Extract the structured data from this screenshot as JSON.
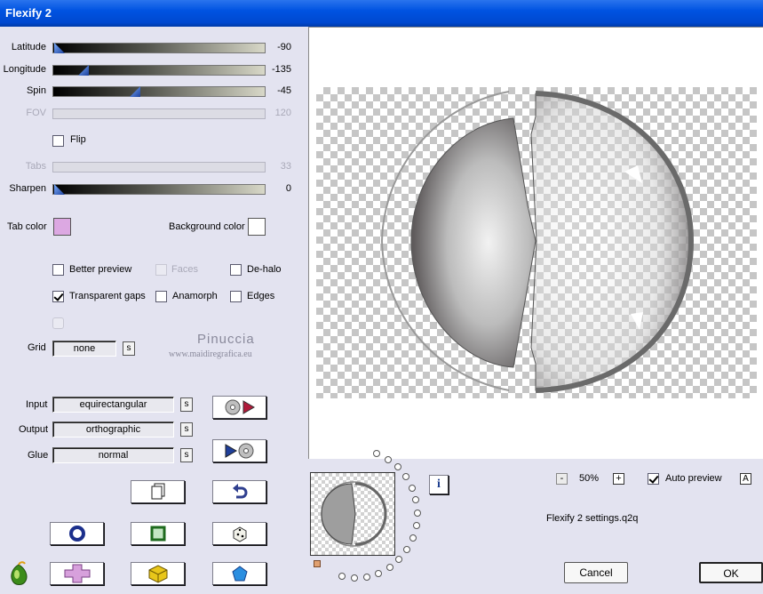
{
  "window": {
    "title": "Flexify 2"
  },
  "sliders": [
    {
      "label": "Latitude",
      "value": "-90",
      "level": 0.0,
      "enabled": true
    },
    {
      "label": "Longitude",
      "value": "-135",
      "level": 0.125,
      "enabled": true
    },
    {
      "label": "Spin",
      "value": "-45",
      "level": 0.375,
      "enabled": true
    },
    {
      "label": "FOV",
      "value": "120",
      "level": 0.0,
      "enabled": false
    },
    {
      "label": "Tabs",
      "value": "33",
      "level": 0.0,
      "enabled": false
    },
    {
      "label": "Sharpen",
      "value": "0",
      "level": 0.0,
      "enabled": true
    }
  ],
  "flip": {
    "label": "Flip",
    "checked": false
  },
  "colors": {
    "tab_label": "Tab color",
    "tab_color": "#dca8e2",
    "bg_label": "Background color",
    "bg_color": "#ffffff"
  },
  "options": {
    "better_preview": "Better preview",
    "faces": "Faces",
    "dehalo": "De-halo",
    "transparent_gaps": "Transparent gaps",
    "anamorph": "Anamorph",
    "edges": "Edges"
  },
  "grid": {
    "label": "Grid",
    "value": "none",
    "s_button": "s"
  },
  "watermark": {
    "name": "Pinuccia",
    "site": "www.maidiregrafica.eu"
  },
  "projection": {
    "input_label": "Input",
    "input_value": "equirectangular",
    "output_label": "Output",
    "output_value": "orthographic",
    "glue_label": "Glue",
    "glue_value": "normal",
    "s_button": "s"
  },
  "zoom": {
    "minus": "-",
    "value": "50%",
    "plus": "+"
  },
  "auto_preview": {
    "label": "Auto preview",
    "checked": true,
    "button": "A"
  },
  "info_icon": "i",
  "settings_file": "Flexify 2 settings.q2q",
  "buttons": {
    "cancel": "Cancel",
    "ok": "OK"
  }
}
